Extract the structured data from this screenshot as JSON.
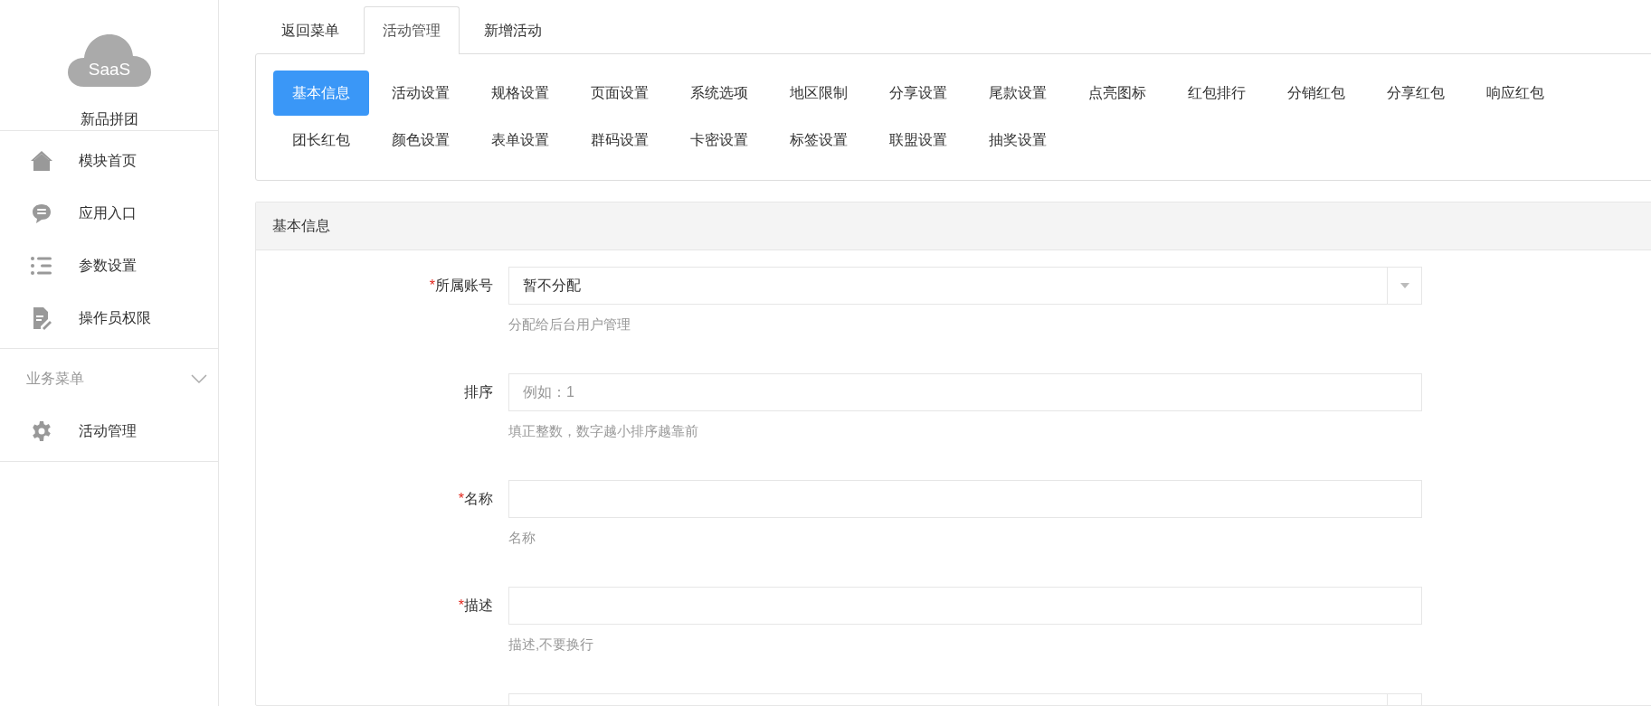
{
  "sidebar": {
    "logo_text": "SaaS",
    "app_name": "新品拼团",
    "items": [
      {
        "label": "模块首页"
      },
      {
        "label": "应用入口"
      },
      {
        "label": "参数设置"
      },
      {
        "label": "操作员权限"
      }
    ],
    "section": {
      "title": "业务菜单",
      "expanded": true,
      "items": [
        {
          "label": "活动管理"
        }
      ]
    }
  },
  "tabs": [
    {
      "label": "返回菜单",
      "selected": false
    },
    {
      "label": "活动管理",
      "selected": true
    },
    {
      "label": "新增活动",
      "selected": false
    }
  ],
  "sub_tabs": [
    {
      "label": "基本信息",
      "selected": true
    },
    {
      "label": "活动设置",
      "selected": false
    },
    {
      "label": "规格设置",
      "selected": false
    },
    {
      "label": "页面设置",
      "selected": false
    },
    {
      "label": "系统选项",
      "selected": false
    },
    {
      "label": "地区限制",
      "selected": false
    },
    {
      "label": "分享设置",
      "selected": false
    },
    {
      "label": "尾款设置",
      "selected": false
    },
    {
      "label": "点亮图标",
      "selected": false
    },
    {
      "label": "红包排行",
      "selected": false
    },
    {
      "label": "分销红包",
      "selected": false
    },
    {
      "label": "分享红包",
      "selected": false
    },
    {
      "label": "响应红包",
      "selected": false
    },
    {
      "label": "团长红包",
      "selected": false
    },
    {
      "label": "颜色设置",
      "selected": false
    },
    {
      "label": "表单设置",
      "selected": false
    },
    {
      "label": "群码设置",
      "selected": false
    },
    {
      "label": "卡密设置",
      "selected": false
    },
    {
      "label": "标签设置",
      "selected": false
    },
    {
      "label": "联盟设置",
      "selected": false
    },
    {
      "label": "抽奖设置",
      "selected": false
    }
  ],
  "panel": {
    "title": "基本信息",
    "fields": [
      {
        "kind": "select",
        "marker": "*",
        "label": "所属账号",
        "value": "暂不分配",
        "help": "分配给后台用户管理"
      },
      {
        "kind": "text",
        "label": "排序",
        "placeholder": "例如：1",
        "help": "填正整数，数字越小排序越靠前"
      },
      {
        "kind": "text",
        "marker": "*",
        "label": "名称",
        "help": "名称"
      },
      {
        "kind": "text",
        "marker": "*",
        "label": "描述",
        "help": "描述,不要换行"
      },
      {
        "kind": "select"
      }
    ]
  }
}
